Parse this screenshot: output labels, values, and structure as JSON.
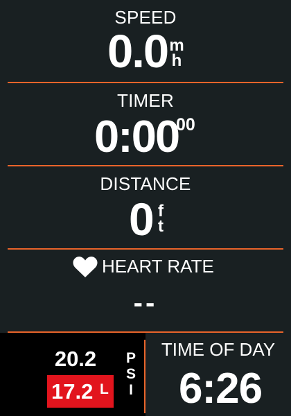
{
  "colors": {
    "background": "#192022",
    "divider": "#e9642a",
    "text": "#ffffff",
    "psi_panel": "#000000",
    "psi_alert": "#e2141d"
  },
  "speed": {
    "label": "SPEED",
    "value": "0.0",
    "unit_top": "m",
    "unit_bottom": "h"
  },
  "timer": {
    "label": "TIMER",
    "main": "0:00",
    "hundredths": "00"
  },
  "distance": {
    "label": "DISTANCE",
    "value": "0",
    "unit_top": "f",
    "unit_bottom": "t"
  },
  "heart_rate": {
    "icon": "heart-icon",
    "label": "HEART RATE",
    "value": "--"
  },
  "tire_pressure": {
    "front": "20.2",
    "rear": "17.2",
    "rear_status": "L",
    "unit": {
      "line1": "P",
      "line2": "S",
      "line3": "I"
    }
  },
  "time_of_day": {
    "label": "TIME OF DAY",
    "value": "6:26"
  }
}
